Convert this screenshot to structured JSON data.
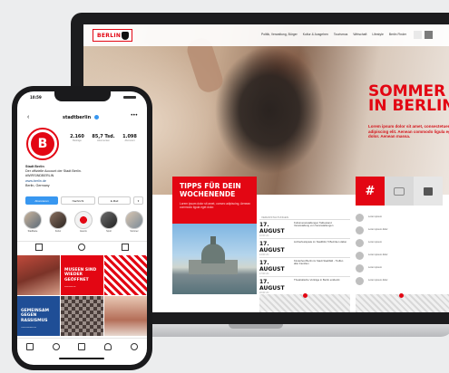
{
  "colors": {
    "accent": "#e30613",
    "instagram_blue": "#3897f0",
    "promo_blue": "#1f4e96"
  },
  "website": {
    "logo": {
      "text": "BERLIN",
      "icon": "bear-icon"
    },
    "nav": [
      "Politik, Verwaltung, Bürger",
      "Kultur & Ausgehen",
      "Tourismus",
      "Wirtschaft",
      "Lifestyle",
      "Berlin Finder"
    ],
    "header_icons": [
      "grid-icon",
      "menu-icon"
    ],
    "hero": {
      "title_line1": "SOMMER",
      "title_line2": "IN BERLIN",
      "text": "Lorem ipsum dolor sit amet, consectetuer adipiscing elit. Aenean commodo ligula eget dolor. Aenean massa."
    },
    "tiles": [
      {
        "name": "hashtag-tile",
        "glyph": "#"
      },
      {
        "name": "camera-tile",
        "icon": "camera-icon"
      },
      {
        "name": "gallery-tile",
        "icon": "image-icon"
      }
    ],
    "promo": {
      "title_line1": "TIPPS FÜR DEIN",
      "title_line2": "WOCHENENDE",
      "text": "Lorem ipsum dolor sit amet, consec adipiscing. Aenean commodo ligula eget dolor."
    },
    "events_heading": "VERANSTALTUNGEN",
    "events": [
      {
        "date": "17. AUGUST",
        "time": "10:00 Uhr",
        "desc": "Kulturveranstaltungen Tatbestand Veranstaltung von Veranstaltungen"
      },
      {
        "date": "17. AUGUST",
        "time": "14:00 Uhr",
        "desc": "Lichterfestspiele im Stadtbild, 5 Bezirken dabei"
      },
      {
        "date": "17. AUGUST",
        "time": "17:00 Uhr",
        "desc": "Kinderfest Berlin im Stadt Stadtbild - Treffen aller Familien"
      },
      {
        "date": "17. AUGUST",
        "time": "20:00 Uhr",
        "desc": "Theatralische Vorträge in Berlin entdeckt"
      }
    ],
    "social": [
      {
        "text": "Lorem ipsum"
      },
      {
        "text": "Lorem ipsum dolor"
      },
      {
        "text": "Lorem ipsum"
      },
      {
        "text": "Lorem ipsum dolor"
      },
      {
        "text": "Lorem ipsum"
      },
      {
        "text": "Lorem ipsum dolor"
      }
    ]
  },
  "phone": {
    "status_time": "10:59",
    "username": "stadtberlin",
    "avatar_letter": "B",
    "stats": [
      {
        "value": "2.160",
        "label": "Beiträge"
      },
      {
        "value": "85,7 Tsd.",
        "label": "Abonnenten"
      },
      {
        "value": "1.098",
        "label": "Abonniert"
      }
    ],
    "bio": {
      "name": "Stadt Berlin",
      "line1": "Der offizielle Account der Stadt Berlin.",
      "line2": "#WIRSINDBERLIN",
      "link": "www.berlin.de",
      "location": "Berlin, Germany"
    },
    "buttons": {
      "follow": "Abonnieren",
      "message": "Nachricht",
      "email": "E-Mail",
      "more": "▾"
    },
    "highlights": [
      "Stadtfeste",
      "Kultur",
      "Events",
      "Sport",
      "Sommer"
    ],
    "grid": [
      {
        "name": "grid-post-crowd",
        "text": "",
        "sub": ""
      },
      {
        "name": "grid-post-museum",
        "text": "MUSEEN SIND WIEDER GEÖFFNET",
        "sub": "www.berlin.de"
      },
      {
        "name": "grid-post-pattern",
        "text": "",
        "sub": ""
      },
      {
        "name": "grid-post-dance",
        "text": "GEMEINSAM GEGEN RASSISMUS",
        "sub": "#WIRSINDBERLIN"
      },
      {
        "name": "grid-post-pixels",
        "text": "",
        "sub": ""
      },
      {
        "name": "grid-post-people",
        "text": "",
        "sub": ""
      }
    ]
  }
}
